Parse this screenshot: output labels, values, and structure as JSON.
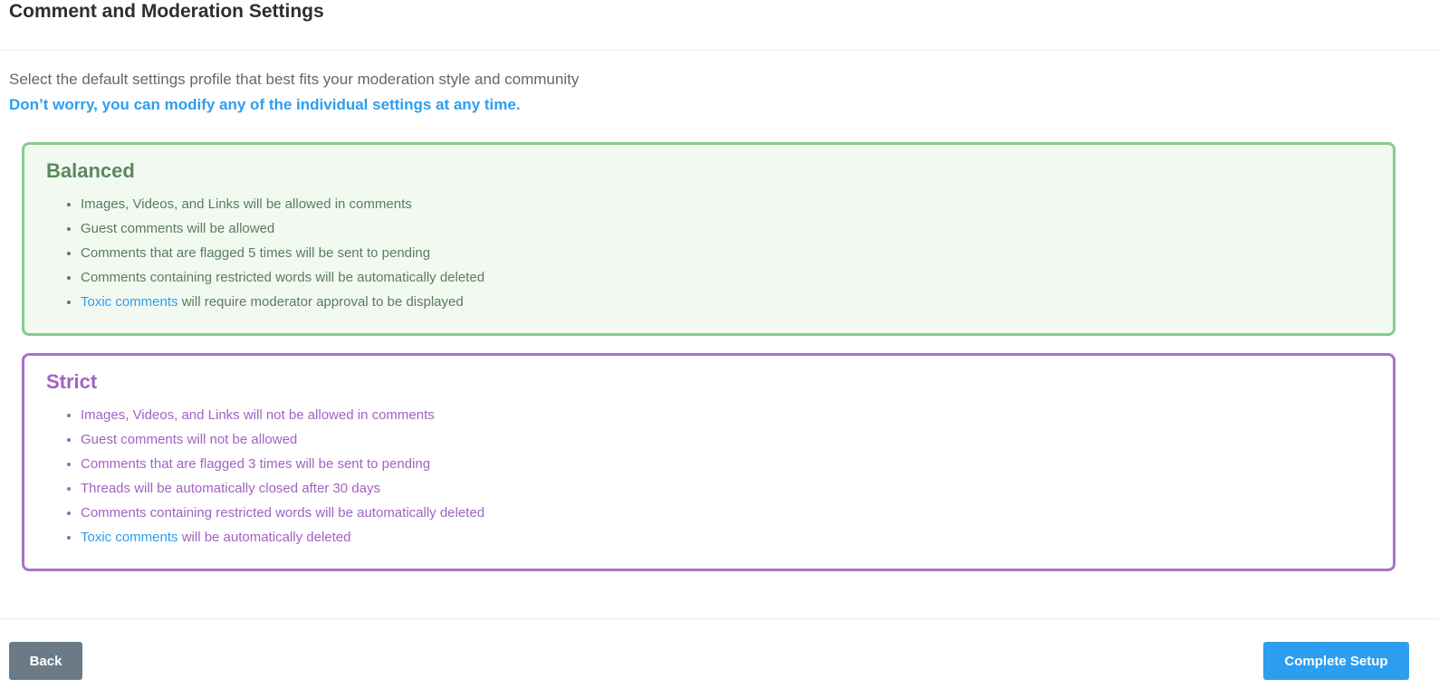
{
  "header": {
    "title": "Comment and Moderation Settings"
  },
  "intro": {
    "description": "Select the default settings profile that best fits your moderation style and community",
    "note": "Don’t worry, you can modify any of the individual settings at any time."
  },
  "profiles": {
    "balanced": {
      "title": "Balanced",
      "items": [
        "Images, Videos, and Links will be allowed in comments",
        "Guest comments will be allowed",
        "Comments that are flagged 5 times will be sent to pending",
        "Comments containing restricted words will be automatically deleted"
      ],
      "toxic_link": "Toxic comments",
      "toxic_rest": " will require moderator approval to be displayed"
    },
    "strict": {
      "title": "Strict",
      "items": [
        "Images, Videos, and Links will not be allowed in comments",
        "Guest comments will not be allowed",
        "Comments that are flagged 3 times will be sent to pending",
        "Threads will be automatically closed after 30 days",
        "Comments containing restricted words will be automatically deleted"
      ],
      "toxic_link": "Toxic comments",
      "toxic_rest": " will be automatically deleted"
    }
  },
  "footer": {
    "back_label": "Back",
    "complete_label": "Complete Setup"
  },
  "colors": {
    "accent": "#2c9ef0",
    "balanced_border": "#86cc8e",
    "balanced_bg": "#f2f9f1",
    "strict_border": "#a873c7",
    "back_button": "#6a7b87"
  }
}
